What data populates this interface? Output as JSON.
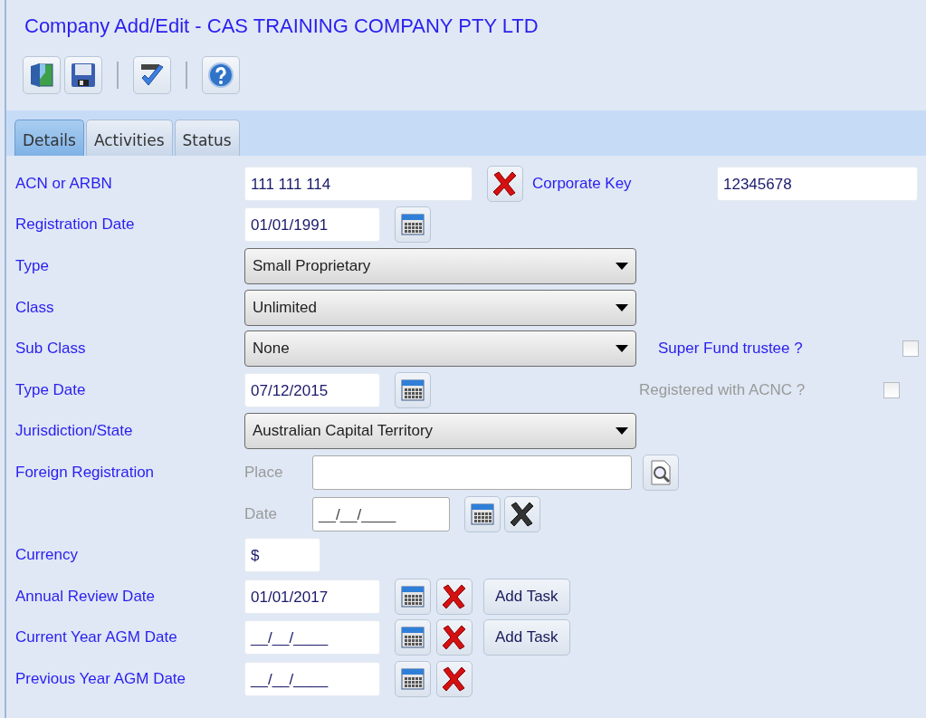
{
  "window": {
    "title": "Company Add/Edit - CAS TRAINING COMPANY PTY LTD"
  },
  "toolbar": [
    {
      "kind": "exit"
    },
    {
      "kind": "save"
    },
    {
      "kind": "separator"
    },
    {
      "kind": "spell"
    },
    {
      "kind": "separator"
    },
    {
      "kind": "help"
    }
  ],
  "tabs": [
    {
      "label": "Details",
      "selected": true
    },
    {
      "label": "Activities",
      "selected": false
    },
    {
      "label": "Status",
      "selected": false
    }
  ],
  "rows": [
    {
      "kind": "text",
      "label": "ACN or ARBN",
      "value": "111 111 114",
      "clear": true,
      "extra": {
        "label": "Corporate Key",
        "value": "12345678"
      }
    },
    {
      "kind": "date",
      "label": "Registration Date",
      "value": "01/01/1991"
    },
    {
      "kind": "select",
      "label": "Type",
      "value": "Small Proprietary"
    },
    {
      "kind": "select",
      "label": "Class",
      "value": "Unlimited"
    },
    {
      "kind": "select",
      "label": "Sub Class",
      "value": "None",
      "check": {
        "label": "Super Fund trustee ?",
        "checked": false,
        "disabled": false
      }
    },
    {
      "kind": "date",
      "label": "Type Date",
      "value": "07/12/2015",
      "check": {
        "label": "Registered with ACNC ?",
        "checked": false,
        "disabled": true
      }
    },
    {
      "kind": "select",
      "label": "Jurisdiction/State",
      "value": "Australian Capital Territory"
    },
    {
      "kind": "foreign",
      "label": "Foreign Registration",
      "place_label": "Place",
      "date_label": "Date",
      "date_value": "__/__/____",
      "disabled": true
    },
    {
      "kind": "short",
      "label": "Currency",
      "value": "$"
    },
    {
      "kind": "date",
      "label": "Annual Review Date",
      "value": "01/01/2017",
      "clear": true,
      "task": "Add Task"
    },
    {
      "kind": "date",
      "label": "Current Year AGM Date",
      "value": "__/__/____",
      "clear": true,
      "task": "Add Task"
    },
    {
      "kind": "date",
      "label": "Previous Year AGM Date",
      "value": "__/__/____",
      "clear": true
    }
  ]
}
